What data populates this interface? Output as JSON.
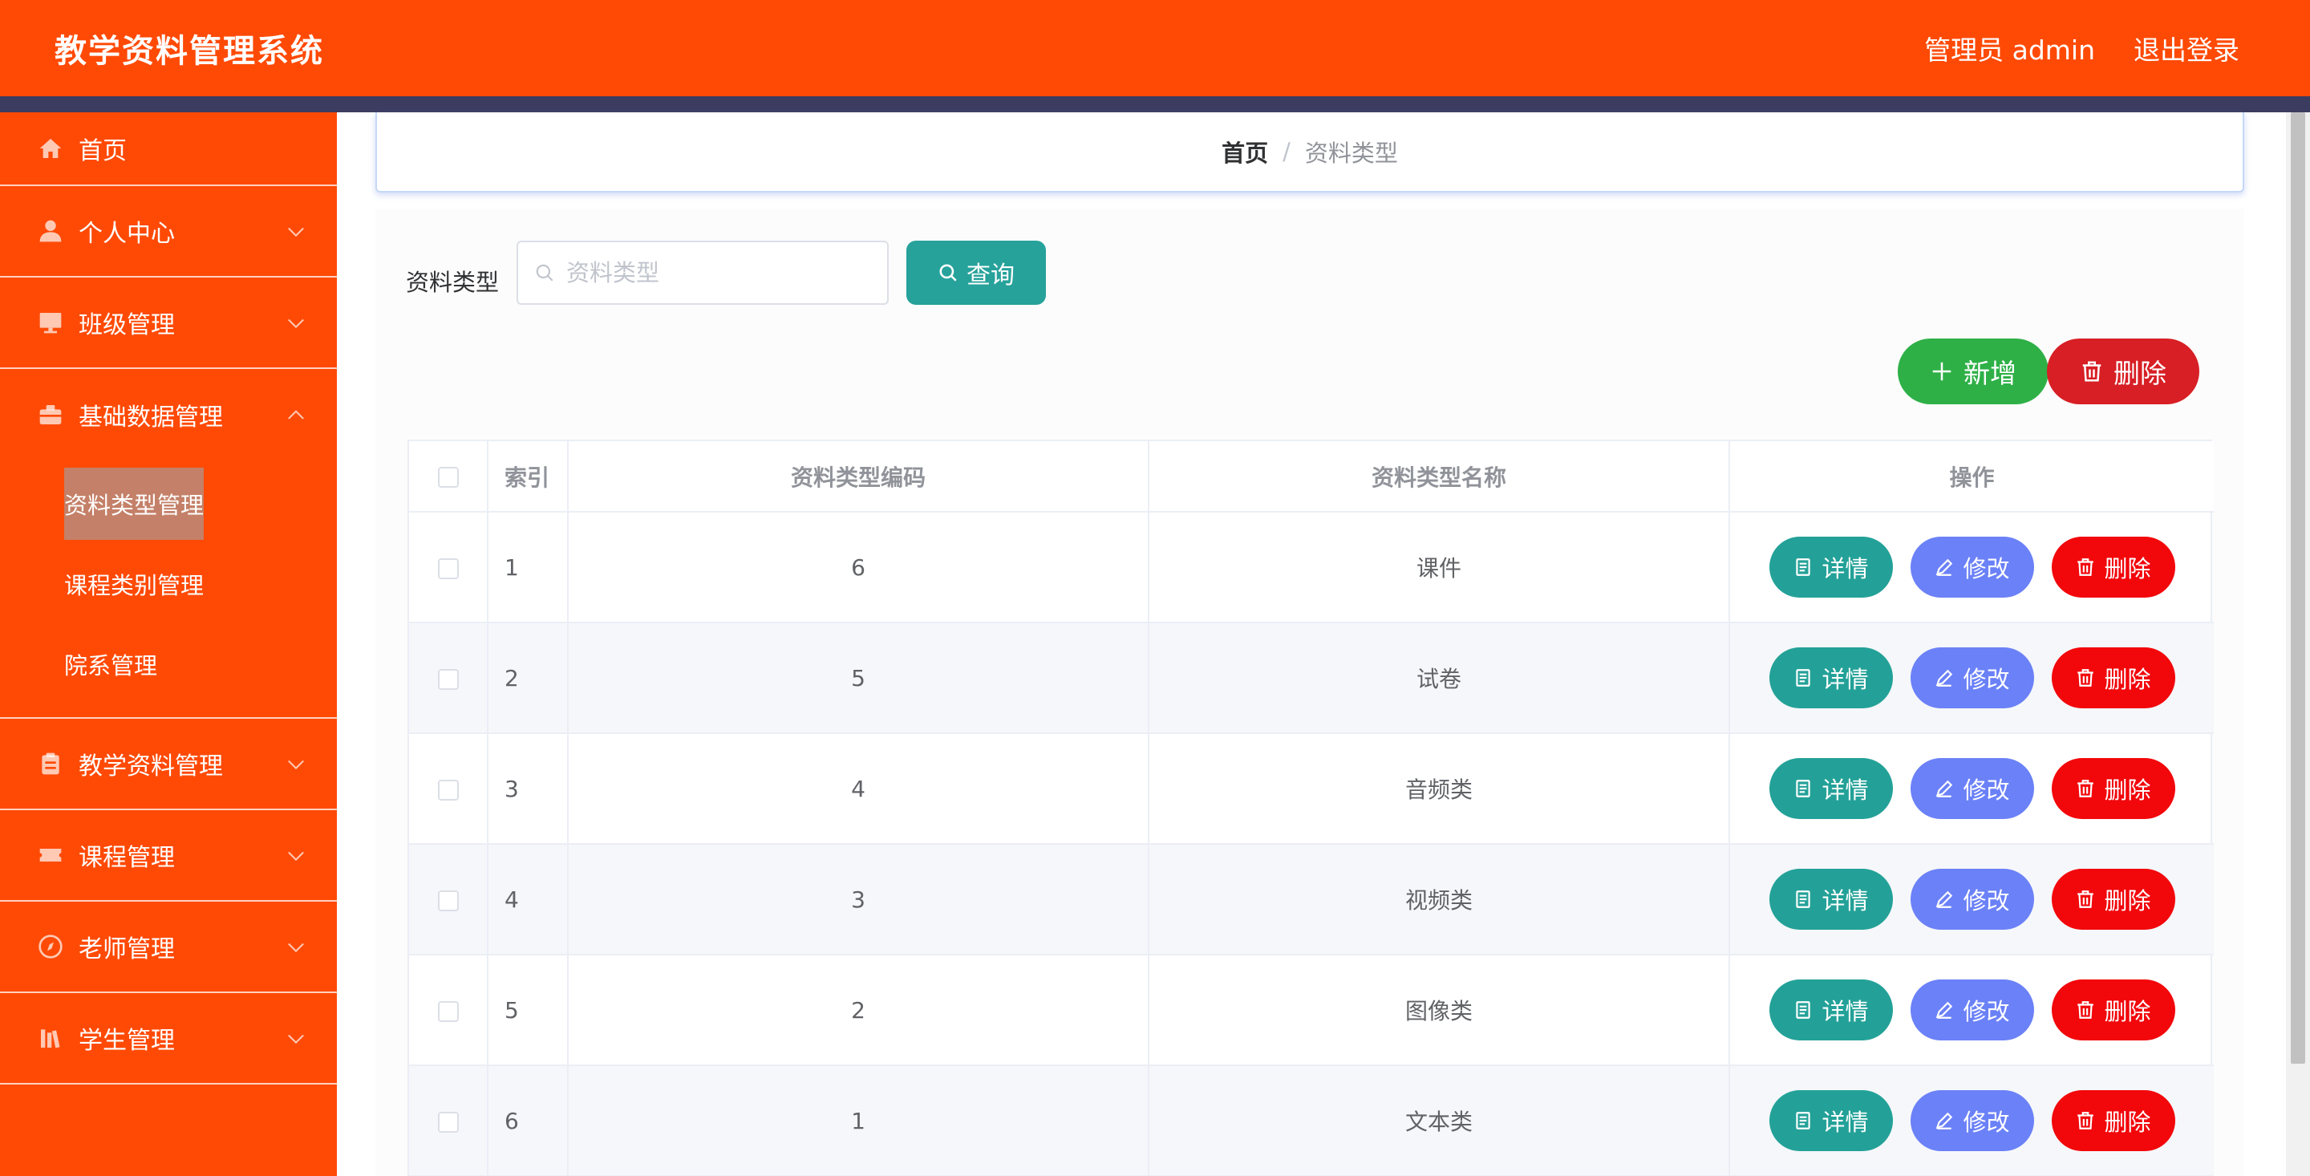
{
  "header": {
    "title": "教学资料管理系统",
    "admin_label": "管理员 admin",
    "logout_label": "退出登录"
  },
  "sidebar": {
    "items": [
      {
        "label": "首页",
        "icon": "home-icon"
      },
      {
        "label": "个人中心",
        "icon": "user-icon"
      },
      {
        "label": "班级管理",
        "icon": "monitor-icon"
      },
      {
        "label": "基础数据管理",
        "icon": "briefcase-icon"
      },
      {
        "label": "教学资料管理",
        "icon": "clipboard-icon"
      },
      {
        "label": "课程管理",
        "icon": "ticket-icon"
      },
      {
        "label": "老师管理",
        "icon": "compass-icon"
      },
      {
        "label": "学生管理",
        "icon": "books-icon"
      }
    ],
    "sub_items": [
      {
        "label": "资料类型管理",
        "active": true
      },
      {
        "label": "课程类别管理",
        "active": false
      },
      {
        "label": "院系管理",
        "active": false
      }
    ]
  },
  "breadcrumb": {
    "home": "首页",
    "separator": "/",
    "current": "资料类型"
  },
  "search": {
    "label": "资料类型",
    "value": "",
    "placeholder": "资料类型",
    "query_label": "查询"
  },
  "toolbar": {
    "add_label": "新增",
    "delete_label": "删除"
  },
  "table": {
    "headers": [
      "索引",
      "资料类型编码",
      "资料类型名称",
      "操作"
    ],
    "rows": [
      {
        "index": "1",
        "code": "6",
        "name": "课件"
      },
      {
        "index": "2",
        "code": "5",
        "name": "试卷"
      },
      {
        "index": "3",
        "code": "4",
        "name": "音频类"
      },
      {
        "index": "4",
        "code": "3",
        "name": "视频类"
      },
      {
        "index": "5",
        "code": "2",
        "name": "图像类"
      },
      {
        "index": "6",
        "code": "1",
        "name": "文本类"
      }
    ],
    "actions": {
      "detail": "详情",
      "edit": "修改",
      "delete": "删除"
    }
  },
  "colors": {
    "brand": "#ff4a06",
    "strip": "#3c3c60",
    "query": "#26a29b",
    "add": "#2eb047",
    "delete_all": "#d71f25",
    "detail": "#23a198",
    "edit": "#6b81f7",
    "delete": "#f2070b"
  }
}
